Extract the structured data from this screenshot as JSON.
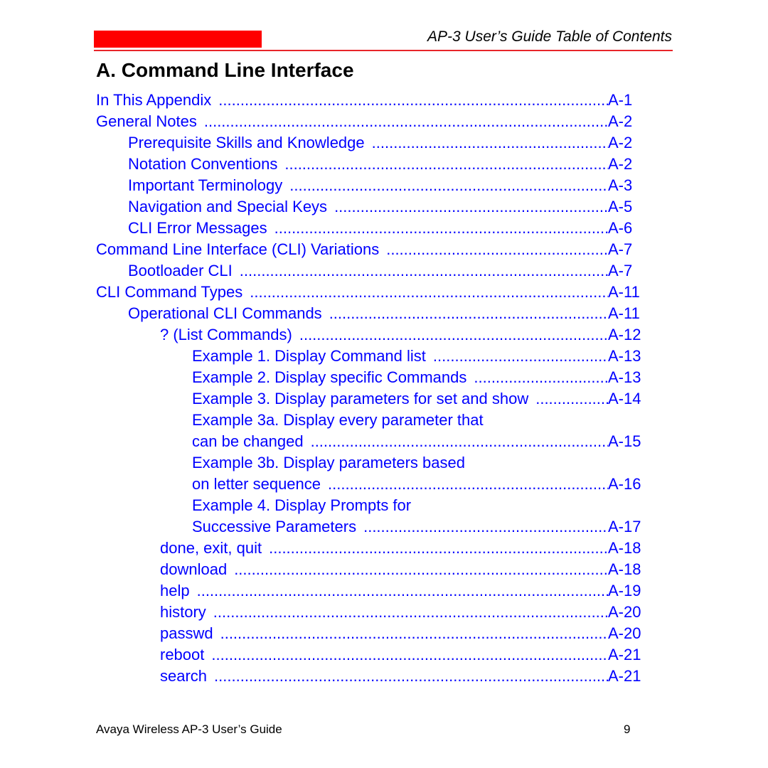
{
  "header": {
    "title": "AP-3 User’s Guide Table of Contents",
    "accent_color": "#ff0000"
  },
  "chapter_title": "A. Command Line Interface",
  "toc": [
    {
      "level": 0,
      "label": "In This Appendix",
      "page": "A-1"
    },
    {
      "level": 0,
      "label": "General Notes",
      "page": "A-2"
    },
    {
      "level": 1,
      "label": "Prerequisite Skills and Knowledge",
      "page": "A-2"
    },
    {
      "level": 1,
      "label": "Notation Conventions",
      "page": "A-2"
    },
    {
      "level": 1,
      "label": "Important Terminology",
      "page": "A-3"
    },
    {
      "level": 1,
      "label": "Navigation and Special Keys",
      "page": "A-5"
    },
    {
      "level": 1,
      "label": "CLI Error Messages",
      "page": "A-6"
    },
    {
      "level": 0,
      "label": "Command Line Interface (CLI) Variations",
      "page": "A-7"
    },
    {
      "level": 1,
      "label": "Bootloader CLI",
      "page": "A-7"
    },
    {
      "level": 0,
      "label": "CLI Command Types",
      "page": "A-11"
    },
    {
      "level": 1,
      "label": "Operational CLI Commands",
      "page": "A-11"
    },
    {
      "level": 2,
      "label": "? (List Commands)",
      "page": "A-12"
    },
    {
      "level": 3,
      "label": "Example 1. Display Command list",
      "page": "A-13"
    },
    {
      "level": 3,
      "label": "Example 2. Display specific Commands",
      "page": "A-13"
    },
    {
      "level": 3,
      "label": "Example 3. Display parameters for set and show",
      "page": "A-14"
    },
    {
      "level": 3,
      "label": "Example 3a. Display every parameter that",
      "page": null
    },
    {
      "level": 3,
      "label": "can be changed",
      "page": "A-15"
    },
    {
      "level": 3,
      "label": "Example 3b. Display parameters based",
      "page": null
    },
    {
      "level": 3,
      "label": "on letter sequence",
      "page": "A-16"
    },
    {
      "level": 3,
      "label": "Example 4. Display Prompts for",
      "page": null
    },
    {
      "level": 3,
      "label": "Successive Parameters",
      "page": "A-17"
    },
    {
      "level": 2,
      "label": "done, exit, quit",
      "page": "A-18"
    },
    {
      "level": 2,
      "label": "download",
      "page": "A-18"
    },
    {
      "level": 2,
      "label": "help",
      "page": "A-19"
    },
    {
      "level": 2,
      "label": "history",
      "page": "A-20"
    },
    {
      "level": 2,
      "label": "passwd",
      "page": "A-20"
    },
    {
      "level": 2,
      "label": "reboot",
      "page": "A-21"
    },
    {
      "level": 2,
      "label": "search",
      "page": "A-21"
    }
  ],
  "link_color": "#0000ff",
  "footer": {
    "left": "Avaya Wireless AP-3 User’s Guide",
    "page_number": "9"
  }
}
